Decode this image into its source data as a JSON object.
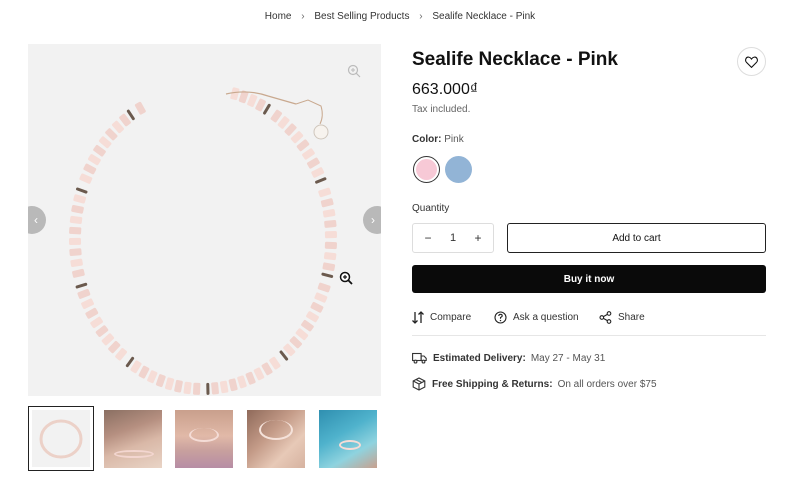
{
  "breadcrumb": {
    "items": [
      "Home",
      "Best Selling Products",
      "Sealife Necklace - Pink"
    ],
    "separator": "›"
  },
  "product": {
    "title": "Sealife Necklace - Pink",
    "price": "663.000₫",
    "tax_note": "Tax included.",
    "color_label": "Color:",
    "color_value": "Pink",
    "swatches": [
      {
        "name": "Pink",
        "color": "#f7c9d6",
        "selected": true
      },
      {
        "name": "Blue",
        "color": "#92b4d6",
        "selected": false
      }
    ],
    "quantity_label": "Quantity",
    "quantity": "1",
    "minus": "−",
    "plus": "+"
  },
  "buttons": {
    "add_to_cart": "Add to cart",
    "buy_now": "Buy it now"
  },
  "actions": {
    "compare": "Compare",
    "ask": "Ask a question",
    "share": "Share"
  },
  "shipping": {
    "delivery_label": "Estimated Delivery:",
    "delivery_value": "May 27 - May 31",
    "shipping_label": "Free Shipping & Returns:",
    "shipping_value": "On all orders over $75"
  },
  "gallery": {
    "prev": "‹",
    "next": "›",
    "thumbnail_count": 5
  },
  "colors": {
    "accent_dark": "#0a0a0a",
    "image_bg": "#f2f2f2"
  }
}
